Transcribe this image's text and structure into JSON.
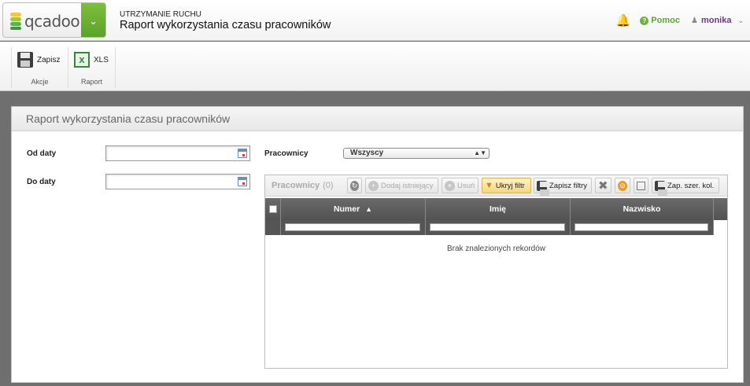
{
  "topbar": {
    "logo_text": "qcadoo",
    "breadcrumb": "UTRZYMANIE RUCHU",
    "title": "Raport wykorzystania czasu pracowników",
    "help_label": "Pomoc",
    "user_name": "monika",
    "brand_color": "#6cb33f"
  },
  "ribbon": {
    "groups": [
      {
        "label": "Akcje",
        "buttons": [
          {
            "label": "Zapisz",
            "icon": "save-icon"
          }
        ]
      },
      {
        "label": "Raport",
        "buttons": [
          {
            "label": "XLS",
            "icon": "excel-icon"
          }
        ]
      }
    ]
  },
  "form": {
    "panel_title": "Raport wykorzystania czasu pracowników",
    "date_from_label": "Od daty",
    "date_from_value": "",
    "date_to_label": "Do daty",
    "date_to_value": "",
    "workers_label": "Pracownicy",
    "workers_selected": "Wszyscy"
  },
  "grid": {
    "title": "Pracownicy",
    "count": "(0)",
    "toolbar": {
      "add_existing": "Dodaj istniejący",
      "delete": "Usuń",
      "hide_filter": "Ukryj filtr",
      "save_filters": "Zapisz filtry",
      "save_col_widths": "Zap. szer. kol."
    },
    "columns": [
      "Numer",
      "Imię",
      "Nazwisko"
    ],
    "sort_column": "Numer",
    "sort_direction": "ascending",
    "empty_message": "Brak znalezionych rekordów"
  }
}
